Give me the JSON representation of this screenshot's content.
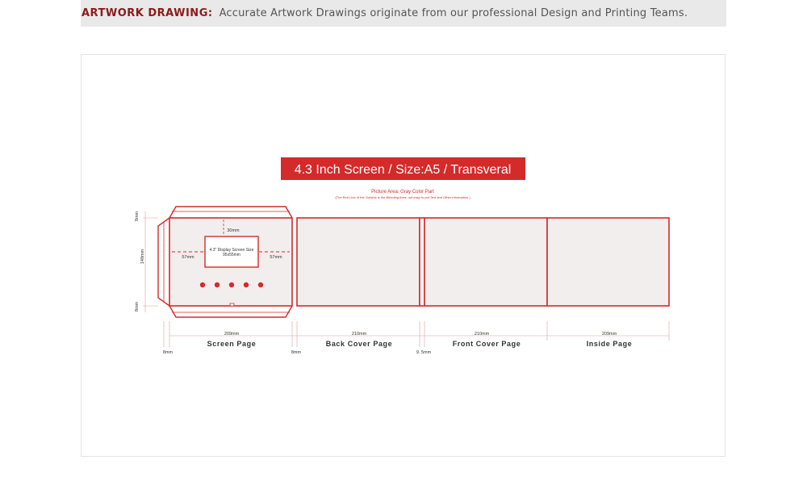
{
  "header": {
    "label": "ARTWORK DRAWING:",
    "description": "Accurate Artwork Drawings originate from our professional Design and Printing Teams."
  },
  "diagram": {
    "banner_title": "4.3 Inch Screen  /  Size:A5 / Transveral",
    "picture_area_note": "Picture Area: Gray Color Part",
    "bleeding_note": "(The Red Line of the Outside is the Bleeding Area, not easy to put Text and Other Information.)",
    "display_label_line1": "4.3\" Display Screen Size",
    "display_label_line2": "95x55mm",
    "dim_30": "30mm",
    "dim_57_left": "57mm",
    "dim_57_right": "57mm",
    "dim_8_top": "8mm",
    "dim_148": "148mm",
    "dim_8_bottom": "8mm",
    "widths": {
      "screen": "209mm",
      "back": "210mm",
      "front": "210mm",
      "inside": "209mm"
    },
    "page_names": {
      "screen": "Screen Page",
      "back": "Back Cover Page",
      "front": "Front Cover Page",
      "inside": "Inside Page"
    },
    "bottom_dims": {
      "left_8": "8mm",
      "mid_8": "8mm",
      "spine": "9. 5mm"
    },
    "colors": {
      "accent_red": "#d42a2a",
      "banner_red": "#d42a2a",
      "panel_fill": "#f3eeee"
    }
  }
}
